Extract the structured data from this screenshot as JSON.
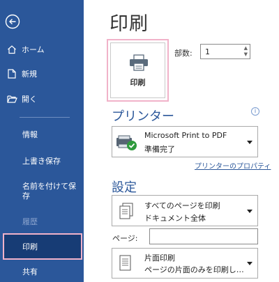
{
  "sidebar": {
    "items": [
      {
        "label": "ホーム"
      },
      {
        "label": "新規"
      },
      {
        "label": "開く"
      },
      {
        "label": "情報"
      },
      {
        "label": "上書き保存"
      },
      {
        "label": "名前を付けて保存"
      },
      {
        "label": "履歴"
      },
      {
        "label": "印刷"
      },
      {
        "label": "共有"
      }
    ]
  },
  "main": {
    "title": "印刷",
    "print_button": {
      "label": "印刷"
    },
    "copies": {
      "label": "部数:",
      "value": "1"
    },
    "printer": {
      "title": "プリンター",
      "name": "Microsoft Print to PDF",
      "status": "準備完了",
      "properties_link": "プリンターのプロパティ"
    },
    "settings": {
      "title": "設定",
      "range": {
        "line1": "すべてのページを印刷",
        "line2": "ドキュメント全体"
      },
      "pages_label": "ページ:",
      "sides": {
        "line1": "片面印刷",
        "line2": "ページの片面のみを印刷し…"
      }
    },
    "info_glyph": "i"
  },
  "colors": {
    "sidebar": "#2b579a",
    "active": "#173c75",
    "accent": "#2b579a",
    "highlight": "#f1b2c9"
  }
}
